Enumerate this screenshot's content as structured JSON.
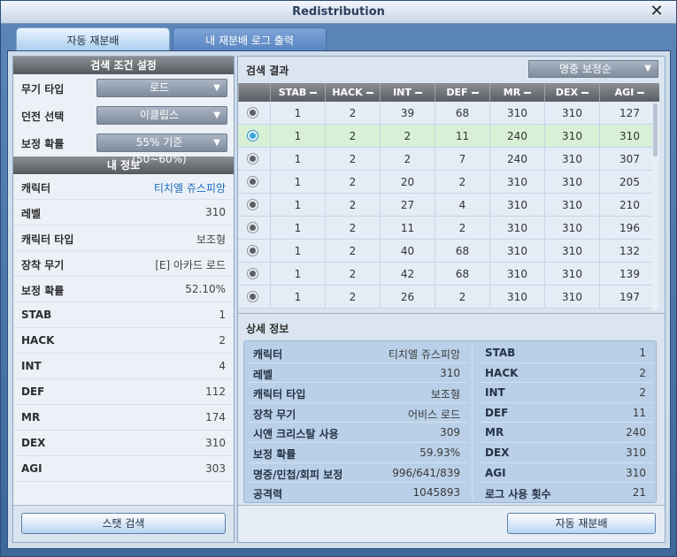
{
  "window": {
    "title": "Redistribution"
  },
  "tabs": [
    {
      "label": "자동 재분배"
    },
    {
      "label": "내 재분배 로그 출력"
    }
  ],
  "search": {
    "header": "검색 조건 설정",
    "filters": [
      {
        "label": "무기 타입",
        "value": "로드"
      },
      {
        "label": "던전 선택",
        "value": "이클립스"
      },
      {
        "label": "보정 확률",
        "value": "55% 기준 (50~60%)"
      }
    ]
  },
  "my_info": {
    "header": "내 정보",
    "rows": [
      {
        "label": "캐릭터",
        "value": "티치엘 쥬스피앙"
      },
      {
        "label": "레벨",
        "value": "310"
      },
      {
        "label": "캐릭터 타입",
        "value": "보조형"
      },
      {
        "label": "장착 무기",
        "value": "[E] 아카드 로드"
      },
      {
        "label": "보정 확률",
        "value": "52.10%"
      },
      {
        "label": "STAB",
        "value": "1"
      },
      {
        "label": "HACK",
        "value": "2"
      },
      {
        "label": "INT",
        "value": "4"
      },
      {
        "label": "DEF",
        "value": "112"
      },
      {
        "label": "MR",
        "value": "174"
      },
      {
        "label": "DEX",
        "value": "310"
      },
      {
        "label": "AGI",
        "value": "303"
      }
    ],
    "stat_search_button": "스탯 검색"
  },
  "results": {
    "title": "검색 결과",
    "sort": "명중 보정순",
    "columns": [
      "STAB",
      "HACK",
      "INT",
      "DEF",
      "MR",
      "DEX",
      "AGI"
    ],
    "rows": [
      {
        "selected": false,
        "values": [
          "1",
          "2",
          "39",
          "68",
          "310",
          "310",
          "127"
        ]
      },
      {
        "selected": true,
        "values": [
          "1",
          "2",
          "2",
          "11",
          "240",
          "310",
          "310"
        ]
      },
      {
        "selected": false,
        "values": [
          "1",
          "2",
          "2",
          "7",
          "240",
          "310",
          "307"
        ]
      },
      {
        "selected": false,
        "values": [
          "1",
          "2",
          "20",
          "2",
          "310",
          "310",
          "205"
        ]
      },
      {
        "selected": false,
        "values": [
          "1",
          "2",
          "27",
          "4",
          "310",
          "310",
          "210"
        ]
      },
      {
        "selected": false,
        "values": [
          "1",
          "2",
          "11",
          "2",
          "310",
          "310",
          "196"
        ]
      },
      {
        "selected": false,
        "values": [
          "1",
          "2",
          "40",
          "68",
          "310",
          "310",
          "132"
        ]
      },
      {
        "selected": false,
        "values": [
          "1",
          "2",
          "42",
          "68",
          "310",
          "310",
          "139"
        ]
      },
      {
        "selected": false,
        "values": [
          "1",
          "2",
          "26",
          "2",
          "310",
          "310",
          "197"
        ]
      }
    ]
  },
  "detail": {
    "title": "상세 정보",
    "left": [
      {
        "label": "캐릭터",
        "value": "티치엘 쥬스피앙"
      },
      {
        "label": "레벨",
        "value": "310"
      },
      {
        "label": "캐릭터 타입",
        "value": "보조형"
      },
      {
        "label": "장착 무기",
        "value": "어비스 로드"
      },
      {
        "label": "시앤 크리스탈 사용",
        "value": "309"
      },
      {
        "label": "보정 확률",
        "value": "59.93%"
      },
      {
        "label": "명중/민첩/회피 보정",
        "value": "996/641/839"
      },
      {
        "label": "공격력",
        "value": "1045893"
      }
    ],
    "right": [
      {
        "label": "STAB",
        "value": "1"
      },
      {
        "label": "HACK",
        "value": "2"
      },
      {
        "label": "INT",
        "value": "2"
      },
      {
        "label": "DEF",
        "value": "11"
      },
      {
        "label": "MR",
        "value": "240"
      },
      {
        "label": "DEX",
        "value": "310"
      },
      {
        "label": "AGI",
        "value": "310"
      },
      {
        "label": "로그 사용 횟수",
        "value": "21"
      }
    ],
    "auto_button": "자동 재분배"
  }
}
